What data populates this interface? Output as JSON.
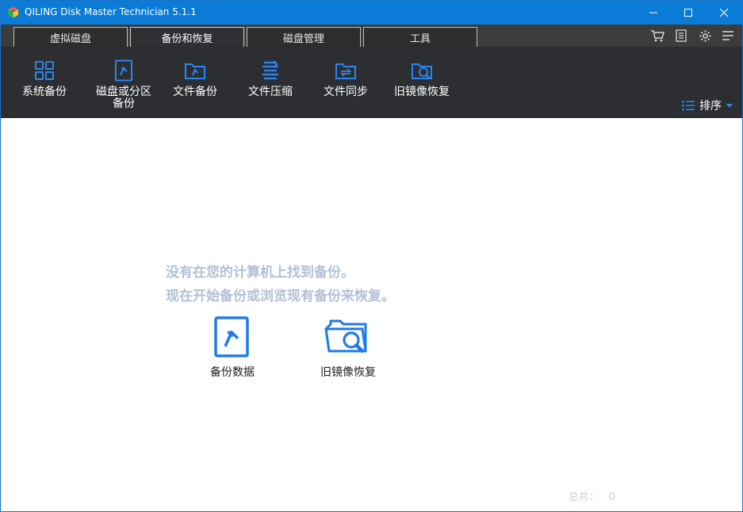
{
  "window": {
    "title": "QILING Disk Master Technician 5.1.1"
  },
  "tabs": [
    {
      "label": "虚拟磁盘"
    },
    {
      "label": "备份和恢复"
    },
    {
      "label": "磁盘管理"
    },
    {
      "label": "工具"
    }
  ],
  "toolbar": {
    "items": [
      {
        "label": "系统备份",
        "icon": "grid-icon"
      },
      {
        "label": "磁盘或分区",
        "label2": "备份",
        "icon": "disk-backup-icon"
      },
      {
        "label": "文件备份",
        "icon": "folder-backup-icon"
      },
      {
        "label": "文件压缩",
        "icon": "compress-icon"
      },
      {
        "label": "文件同步",
        "icon": "folder-sync-icon"
      },
      {
        "label": "旧镜像恢复",
        "icon": "folder-search-icon"
      }
    ],
    "sort_label": "排序"
  },
  "content": {
    "message_line1": "没有在您的计算机上找到备份。",
    "message_line2": "现在开始备份或浏览现有备份来恢复。",
    "actions": [
      {
        "label": "备份数据",
        "icon": "backup-data-icon"
      },
      {
        "label": "旧镜像恢复",
        "icon": "old-image-restore-icon"
      }
    ],
    "total_label": "总共：",
    "total_value": "0"
  },
  "colors": {
    "titlebar": "#0a7bd6",
    "toolbar": "#2d2e32",
    "accent": "#1e7ce6",
    "message": "#b3c0d4"
  }
}
